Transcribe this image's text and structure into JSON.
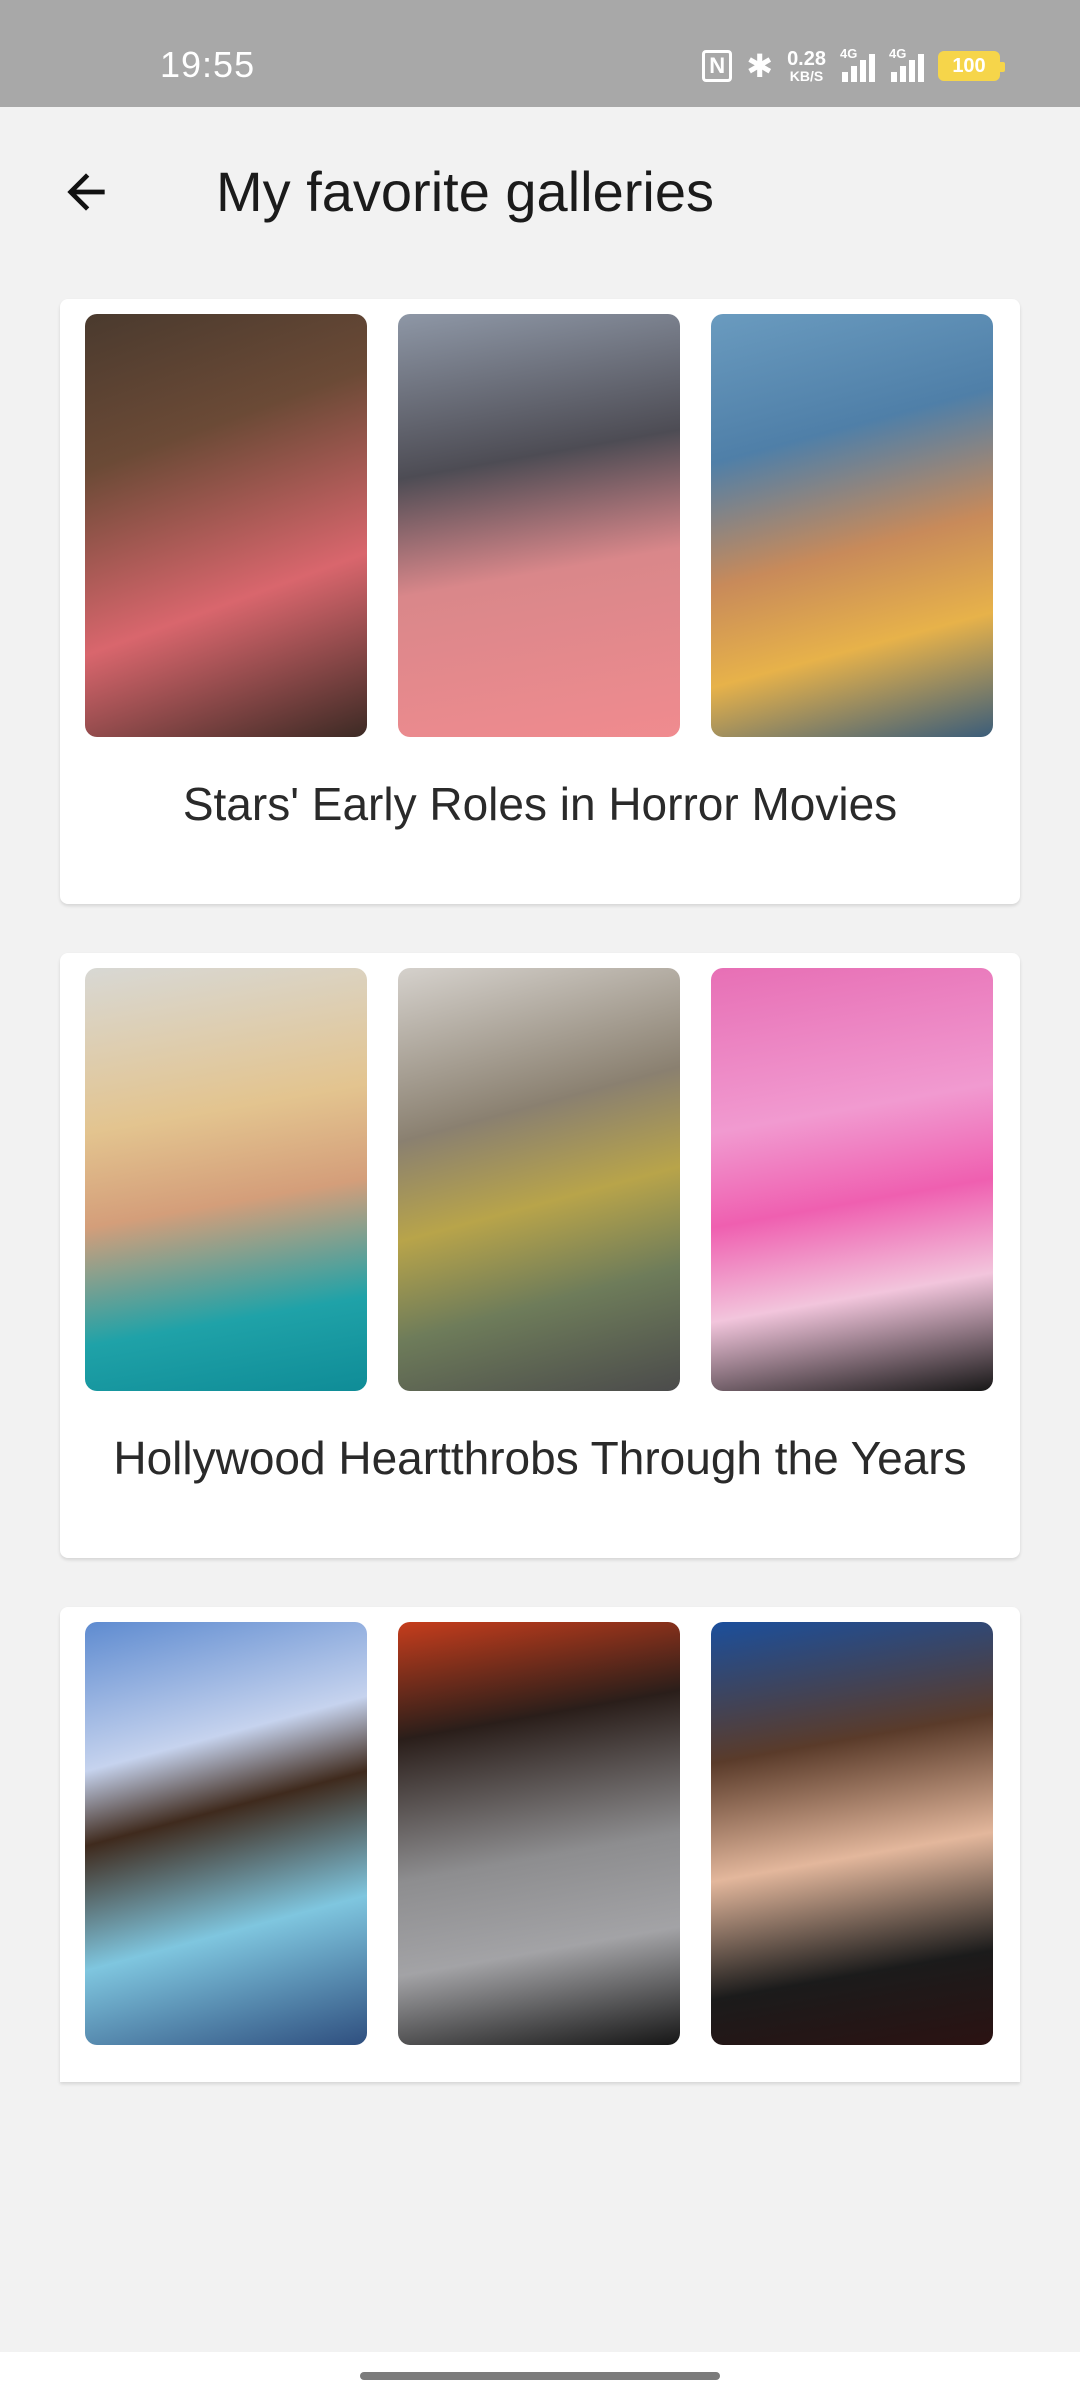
{
  "status_bar": {
    "time": "19:55",
    "nfc_label": "N",
    "net_speed_value": "0.28",
    "net_speed_unit": "KB/S",
    "signal1_label": "4G",
    "signal2_label": "4G",
    "battery": "100"
  },
  "app_bar": {
    "title": "My favorite galleries"
  },
  "galleries": [
    {
      "title": "Stars' Early Roles in Horror Movies"
    },
    {
      "title": "Hollywood Heartthrobs Through the Years"
    },
    {
      "title": ""
    }
  ],
  "colors": {
    "background": "#f2f2f2",
    "status_bar": "#a8a8a8",
    "card": "#ffffff",
    "battery": "#f6d54a"
  }
}
